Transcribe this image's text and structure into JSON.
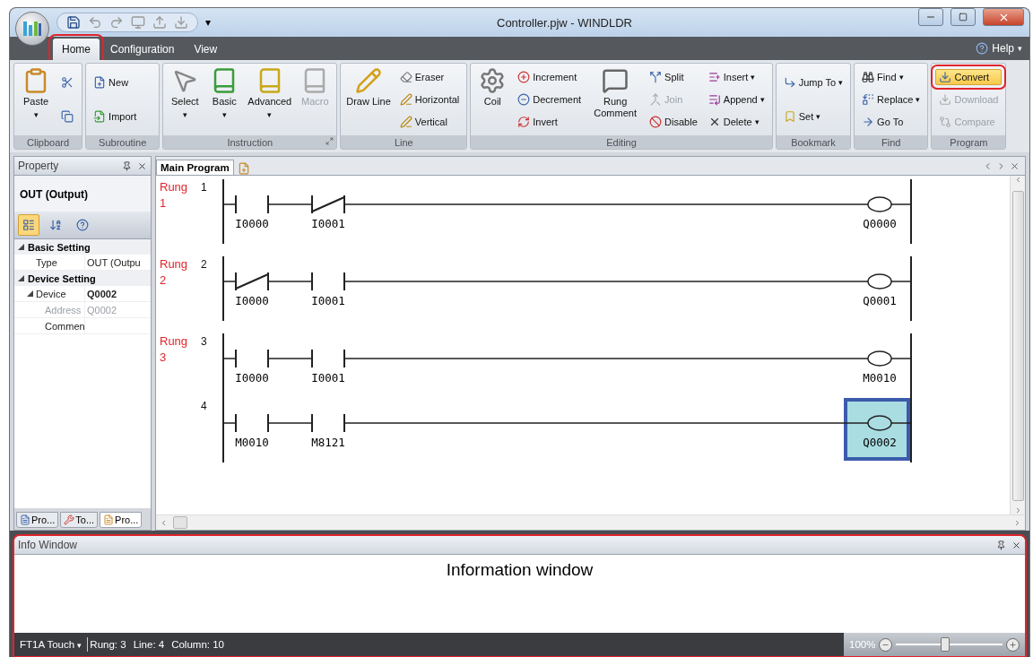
{
  "window": {
    "title": "Controller.pjw - WINDLDR",
    "quick_access": {
      "more": "▾"
    }
  },
  "menu": {
    "tabs": [
      {
        "label": "Home",
        "selected": true,
        "highlighted": true
      },
      {
        "label": "Configuration",
        "selected": false,
        "highlighted": false
      },
      {
        "label": "View",
        "selected": false,
        "highlighted": false
      }
    ],
    "help": "Help",
    "help_caret": "▾"
  },
  "ribbon": {
    "groups": [
      {
        "label": "Clipboard",
        "items": [
          {
            "kind": "large",
            "label": "Paste",
            "caret": "▾",
            "disabled": false
          },
          {
            "kind": "small",
            "disabled": false
          },
          {
            "kind": "small",
            "disabled": false
          }
        ]
      },
      {
        "label": "Subroutine",
        "items": [
          {
            "kind": "small",
            "label": "New",
            "disabled": false
          },
          {
            "kind": "small",
            "label": "Import",
            "disabled": false
          }
        ]
      },
      {
        "label": "Instruction",
        "launcher": true,
        "items": [
          {
            "kind": "large",
            "label": "Select",
            "caret": "▾",
            "disabled": false
          },
          {
            "kind": "large",
            "label": "Basic",
            "caret": "▾",
            "disabled": false
          },
          {
            "kind": "large",
            "label": "Advanced",
            "caret": "▾",
            "disabled": false
          },
          {
            "kind": "large",
            "label": "Macro",
            "disabled": true
          }
        ]
      },
      {
        "label": "Line",
        "items": [
          {
            "kind": "large",
            "label": "Draw Line",
            "disabled": false
          },
          {
            "kind": "small",
            "label": "Eraser",
            "disabled": false
          },
          {
            "kind": "small",
            "label": "Horizontal",
            "disabled": false
          },
          {
            "kind": "small",
            "label": "Vertical",
            "disabled": false
          }
        ]
      },
      {
        "label": "Editing",
        "items": [
          {
            "kind": "large",
            "label": "Coil",
            "disabled": false
          },
          {
            "kind": "small",
            "label": "Increment",
            "disabled": false
          },
          {
            "kind": "small",
            "label": "Decrement",
            "disabled": false
          },
          {
            "kind": "small",
            "label": "Invert",
            "disabled": false
          },
          {
            "kind": "large",
            "label": "Rung Comment",
            "disabled": false
          },
          {
            "kind": "small",
            "label": "Split",
            "disabled": false
          },
          {
            "kind": "small",
            "label": "Join",
            "disabled": true
          },
          {
            "kind": "small",
            "label": "Disable",
            "disabled": false
          },
          {
            "kind": "small",
            "label": "Insert",
            "caret": "▾",
            "disabled": false
          },
          {
            "kind": "small",
            "label": "Append",
            "caret": "▾",
            "disabled": false
          },
          {
            "kind": "small",
            "label": "Delete",
            "caret": "▾",
            "disabled": false
          }
        ]
      },
      {
        "label": "Bookmark",
        "items": [
          {
            "kind": "small",
            "label": "Jump To",
            "caret": "▾",
            "disabled": false
          },
          {
            "kind": "small",
            "label": "Set",
            "caret": "▾",
            "disabled": false
          }
        ]
      },
      {
        "label": "Find",
        "items": [
          {
            "kind": "small",
            "label": "Find",
            "caret": "▾",
            "disabled": false
          },
          {
            "kind": "small",
            "label": "Replace",
            "caret": "▾",
            "disabled": false
          },
          {
            "kind": "small",
            "label": "Go To",
            "disabled": false
          }
        ]
      },
      {
        "label": "Program",
        "items": [
          {
            "kind": "small",
            "label": "Convert",
            "disabled": false,
            "highlighted": true
          },
          {
            "kind": "small",
            "label": "Download",
            "disabled": true
          },
          {
            "kind": "small",
            "label": "Compare",
            "disabled": true
          }
        ]
      }
    ]
  },
  "property_panel": {
    "title": "Property",
    "heading": "OUT (Output)",
    "toolbar": [
      {
        "selected": true
      },
      {
        "selected": false
      },
      {
        "selected": false
      }
    ],
    "grid": [
      {
        "kind": "group",
        "label": "Basic Setting",
        "expanded": true,
        "children": [
          {
            "kind": "property",
            "label": "Type",
            "value": "OUT (Outpu",
            "disabled": false,
            "changed": false
          }
        ]
      },
      {
        "kind": "group",
        "label": "Device Setting",
        "expanded": true,
        "children": [
          {
            "kind": "property",
            "label": "Device",
            "value": "Q0002",
            "expanded": true,
            "disabled": false,
            "changed": true,
            "children": [
              {
                "kind": "property",
                "label": "Address",
                "value": "Q0002",
                "disabled": true,
                "changed": false
              },
              {
                "kind": "property",
                "label": "Commen",
                "disabled": false,
                "changed": false
              }
            ]
          }
        ]
      }
    ],
    "tabs": [
      {
        "label": "Pro...",
        "selected": false
      },
      {
        "label": "To...",
        "selected": false
      },
      {
        "label": "Pro...",
        "selected": true
      }
    ]
  },
  "editor": {
    "tabs": [
      {
        "label": "Main Program",
        "selected": true
      }
    ],
    "rungs": [
      {
        "label": "Rung",
        "number": "1",
        "lines": [
          {
            "number": "1",
            "contacts": [
              {
                "kind": "no",
                "label": "I0000"
              },
              {
                "kind": "nc",
                "label": "I0001"
              }
            ],
            "coil": {
              "label": "Q0000",
              "selected": false
            }
          }
        ]
      },
      {
        "label": "Rung",
        "number": "2",
        "lines": [
          {
            "number": "2",
            "contacts": [
              {
                "kind": "nc",
                "label": "I0000"
              },
              {
                "kind": "no",
                "label": "I0001"
              }
            ],
            "coil": {
              "label": "Q0001",
              "selected": false
            }
          }
        ]
      },
      {
        "label": "Rung",
        "number": "3",
        "lines": [
          {
            "number": "3",
            "contacts": [
              {
                "kind": "no",
                "label": "I0000"
              },
              {
                "kind": "no",
                "label": "I0001"
              }
            ],
            "coil": {
              "label": "M0010",
              "selected": false
            }
          },
          {
            "number": "4",
            "contacts": [
              {
                "kind": "no",
                "label": "M0010"
              },
              {
                "kind": "no",
                "label": "M8121"
              }
            ],
            "coil": {
              "label": "Q0002",
              "selected": true
            }
          }
        ]
      }
    ]
  },
  "info_window": {
    "title": "Info Window",
    "annotation": "Information window",
    "highlighted": true
  },
  "status_bar": {
    "device": "FT1A Touch",
    "device_caret": "▾",
    "fields": [
      "Rung: 3",
      "Line: 4",
      "Column: 10"
    ],
    "zoom": {
      "reading": "100%",
      "level": 0.45
    }
  }
}
